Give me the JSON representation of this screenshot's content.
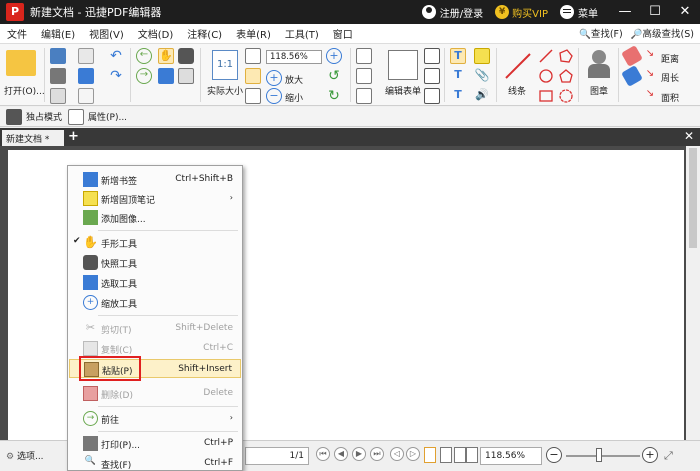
{
  "window": {
    "doc_title": "新建文档",
    "separator": "-",
    "app_name": "迅捷PDF编辑器",
    "login": "注册/登录",
    "vip": "购买VIP",
    "vip_badge": "¥",
    "menu": "菜单",
    "controls": [
      "—",
      "☐",
      "✕"
    ]
  },
  "menubar": {
    "items": [
      "文件",
      "编辑(E)",
      "视图(V)",
      "文档(D)",
      "注释(C)",
      "表单(R)",
      "工具(T)",
      "窗口"
    ],
    "right": [
      "查找(F)",
      "高级查找(S)"
    ]
  },
  "ribbon": {
    "open_label": "打开(O)...",
    "zoom_value": "118.56%",
    "actual_size_label": "实际大小",
    "zoom_in_label": "放大",
    "zoom_out_label": "缩小",
    "edit_form_label": "编辑表单",
    "lines_label": "线条",
    "stamp_label": "图章",
    "distance_label": "距离",
    "perimeter_label": "周长",
    "area_label": "面积"
  },
  "subbar": {
    "exclusive_mode": "独占模式",
    "properties": "属性(P)..."
  },
  "tab": {
    "label": "新建文档 *",
    "add": "+",
    "close": "✕"
  },
  "context_menu": {
    "items": [
      {
        "label": "新增书签",
        "shortcut": "Ctrl+Shift+B"
      },
      {
        "label": "新增固顶笔记",
        "shortcut": ""
      },
      {
        "label": "添加图像...",
        "shortcut": ""
      },
      {
        "label": "手形工具",
        "shortcut": ""
      },
      {
        "label": "快照工具",
        "shortcut": ""
      },
      {
        "label": "选取工具",
        "shortcut": ""
      },
      {
        "label": "缩放工具",
        "shortcut": ""
      },
      {
        "label": "剪切(T)",
        "shortcut": "Shift+Delete"
      },
      {
        "label": "复制(C)",
        "shortcut": "Ctrl+C"
      },
      {
        "label": "粘贴(P)",
        "shortcut": "Shift+Insert"
      },
      {
        "label": "删除(D)",
        "shortcut": "Delete"
      },
      {
        "label": "前往",
        "shortcut": ""
      },
      {
        "label": "打印(P)...",
        "shortcut": "Ctrl+P"
      },
      {
        "label": "查找(F)",
        "shortcut": "Ctrl+F"
      }
    ],
    "arrow": "›",
    "check": "✔"
  },
  "statusbar": {
    "options": "选项...",
    "page_indicator": "1/1",
    "zoom_value": "118.56%",
    "zoom_out_symbol": "−",
    "zoom_in_symbol": "+"
  },
  "colors": {
    "title_bg": "#1e1e1e",
    "vip_gold": "#f0c020",
    "highlight_box": "#e02020",
    "menu_highlight": "#fdf1c9"
  }
}
